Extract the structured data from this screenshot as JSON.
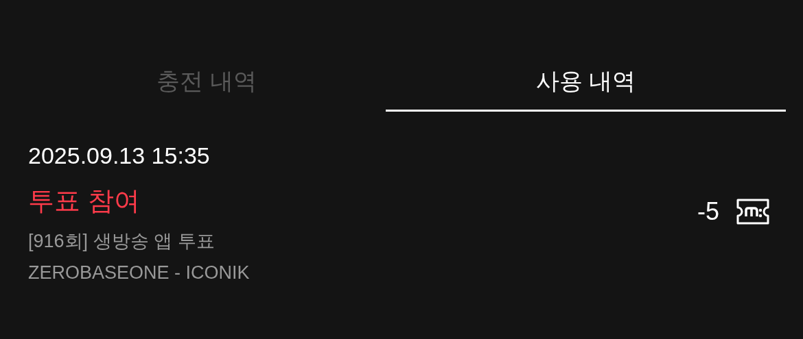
{
  "tabs": [
    {
      "label": "충전 내역",
      "selected": false
    },
    {
      "label": "사용 내역",
      "selected": true
    }
  ],
  "entries": [
    {
      "datetime": "2025.09.13 15:35",
      "title": "투표 참여",
      "details": [
        "[916회] 생방송 앱 투표",
        "ZEROBASEONE - ICONIK"
      ],
      "amount": "-5"
    }
  ]
}
